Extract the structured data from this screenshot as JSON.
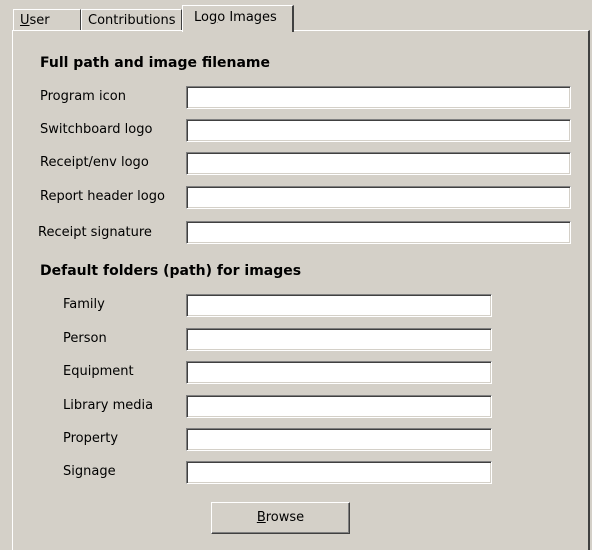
{
  "tabs": {
    "user": {
      "mnemonic": "U",
      "rest": "ser"
    },
    "contributions": "Contributions",
    "logo_images": {
      "pre": "Lo",
      "mnemonic": "g",
      "rest": "o Images"
    }
  },
  "section1": {
    "title": "Full path and image filename",
    "fields": {
      "program_icon": {
        "label": "Program icon",
        "value": ""
      },
      "switchboard_logo": {
        "label": "Switchboard logo",
        "value": ""
      },
      "receipt_env_logo": {
        "label": "Receipt/env logo",
        "value": ""
      },
      "report_header_logo": {
        "label": "Report header logo",
        "value": ""
      },
      "receipt_signature": {
        "label": "Receipt signature",
        "value": ""
      }
    }
  },
  "section2": {
    "title": "Default folders (path) for images",
    "fields": {
      "family": {
        "label": "Family",
        "value": ""
      },
      "person": {
        "label": "Person",
        "value": ""
      },
      "equipment": {
        "label": "Equipment",
        "value": ""
      },
      "library_media": {
        "label": "Library media",
        "value": ""
      },
      "property": {
        "label": "Property",
        "value": ""
      },
      "signage": {
        "label": "Signage",
        "value": ""
      }
    }
  },
  "browse": {
    "mnemonic": "B",
    "rest": "rowse"
  }
}
